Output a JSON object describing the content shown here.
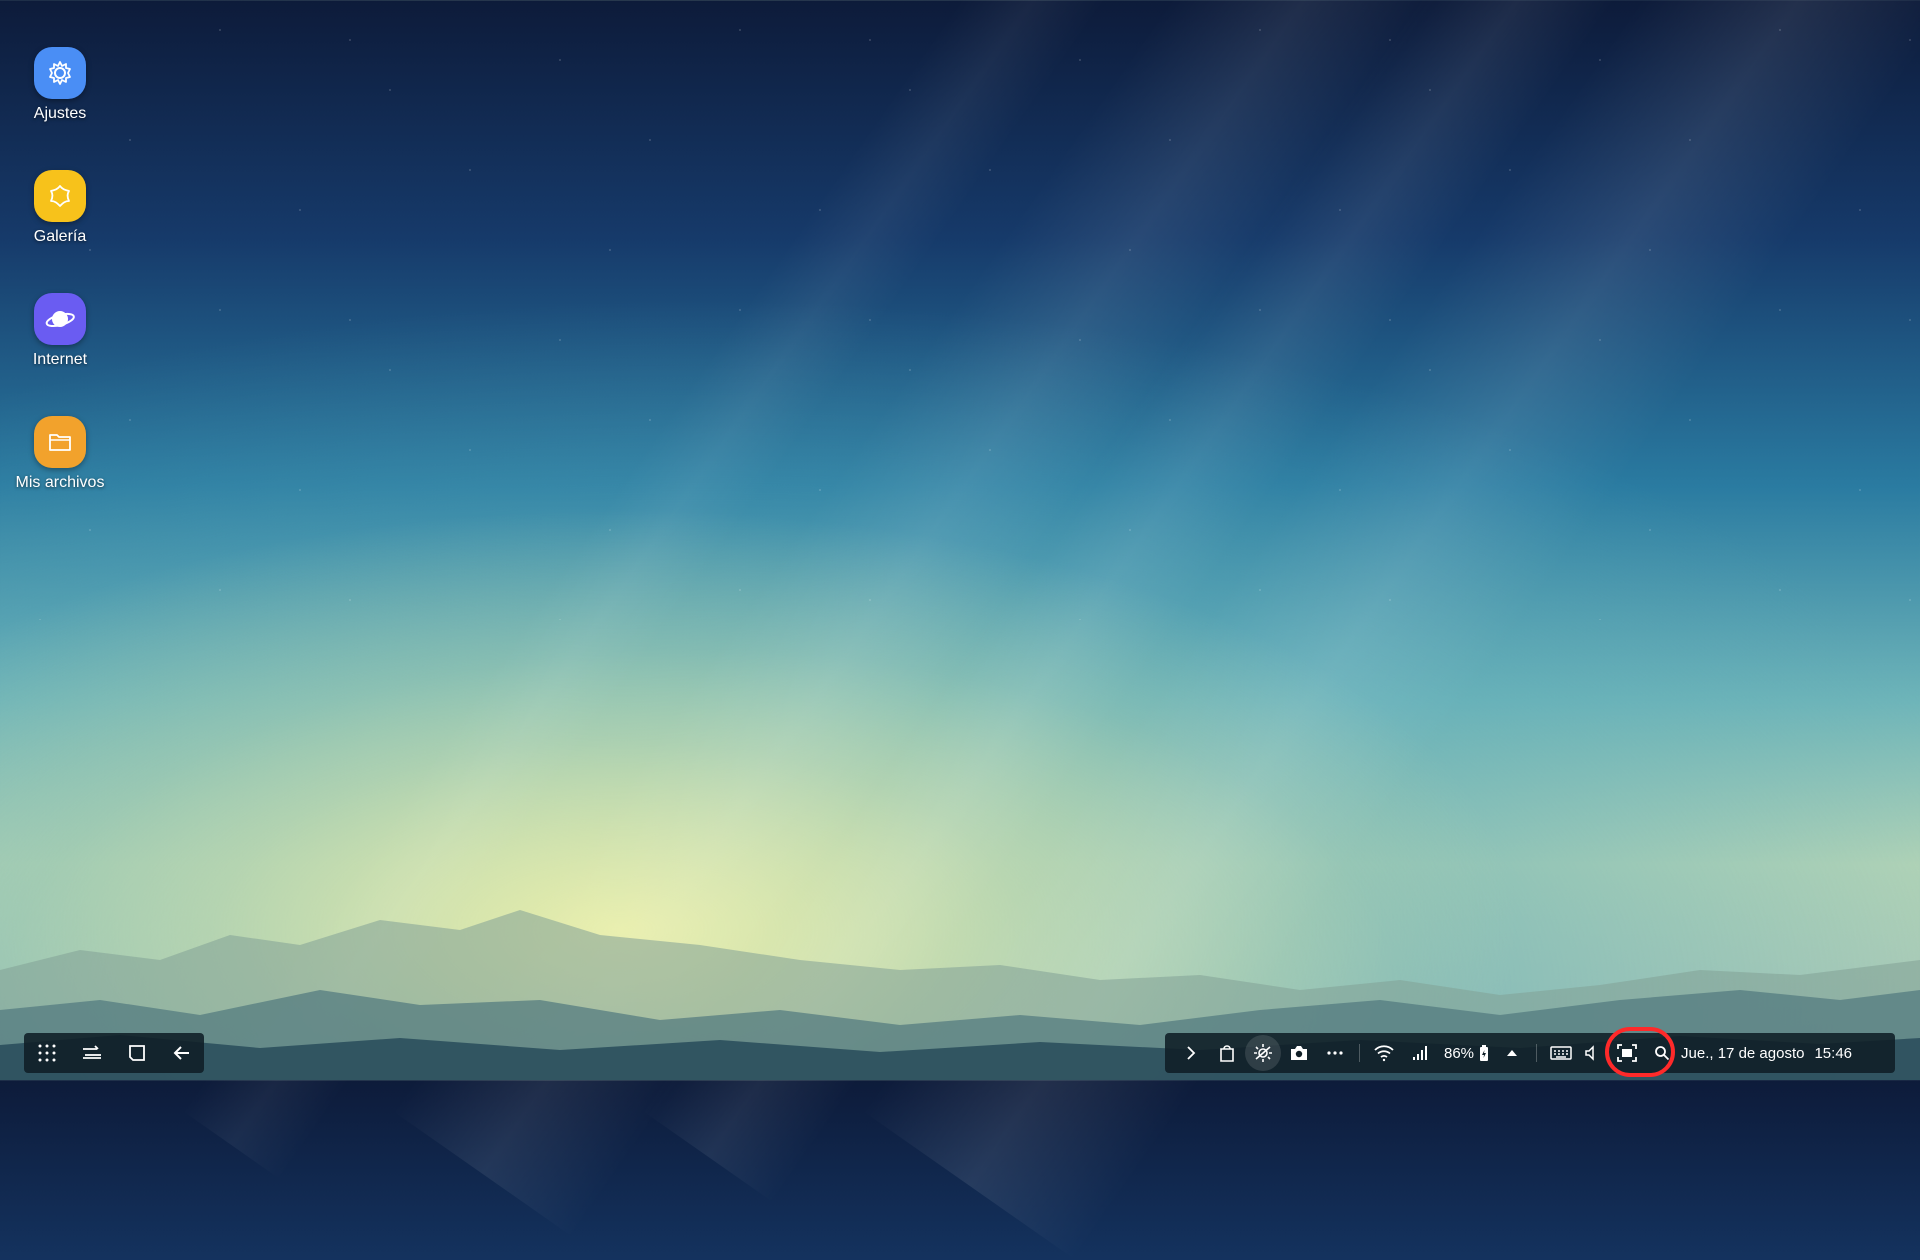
{
  "desktop_icons": [
    {
      "label": "Ajustes",
      "icon": "gear-icon",
      "color": "#4a8ef5"
    },
    {
      "label": "Galería",
      "icon": "flower-icon",
      "color": "#f7c21b"
    },
    {
      "label": "Internet",
      "icon": "planet-icon",
      "color": "#6a5cf2"
    },
    {
      "label": "Mis archivos",
      "icon": "folder-icon",
      "color": "#f2a22c"
    }
  ],
  "taskbar_left": {
    "buttons": [
      "apps-grid-icon",
      "recent-apps-icon",
      "home-icon",
      "back-arrow-icon"
    ]
  },
  "taskbar_right": {
    "quick_icons": [
      "expand-chevron-icon",
      "store-bag-icon",
      "do-not-disturb-icon",
      "camera-icon",
      "more-dots-icon"
    ],
    "status_icons": [
      "wifi-icon",
      "signal-icon"
    ],
    "battery_percent": "86%",
    "date": "Jue., 17 de agosto",
    "time": "15:46"
  },
  "colors": {
    "taskbar_bg": "#0f1e26",
    "highlight": "#ff2a2a"
  }
}
